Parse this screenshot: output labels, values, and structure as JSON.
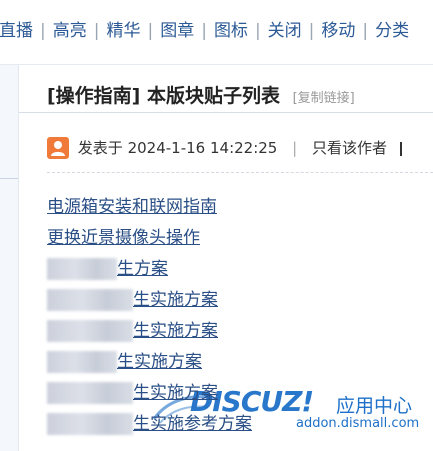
{
  "toolbar": {
    "items": [
      "直播",
      "高亮",
      "精华",
      "图章",
      "图标",
      "关闭",
      "移动",
      "分类"
    ]
  },
  "thread": {
    "title": "[操作指南] 本版块贴子列表",
    "copy_link": "[复制链接]",
    "posted_label": "发表于",
    "posted_at": "2024-1-16 14:22:25",
    "separator": "|",
    "author_only": "只看该作者"
  },
  "posts": [
    {
      "prefix": "",
      "text": "电源箱安装和联网指南"
    },
    {
      "prefix": "",
      "text": "更换近景摄像头操作"
    },
    {
      "prefix": "",
      "text": "生方案"
    },
    {
      "prefix": "",
      "text": "生实施方案"
    },
    {
      "prefix": "",
      "text": "生实施方案"
    },
    {
      "prefix": "",
      "text": "生实施方案"
    },
    {
      "prefix": "",
      "text": "生实施方案"
    },
    {
      "prefix": "",
      "text": "生实施参考方案"
    }
  ],
  "watermark": {
    "logo": "DISCUZ!",
    "sub": "应用中心",
    "url": "addon.dismall.com"
  },
  "colors": {
    "link": "#2a4f86",
    "toolbar": "#2c5a96",
    "brand": "#1e70c8",
    "avatar": "#f07a3a"
  }
}
